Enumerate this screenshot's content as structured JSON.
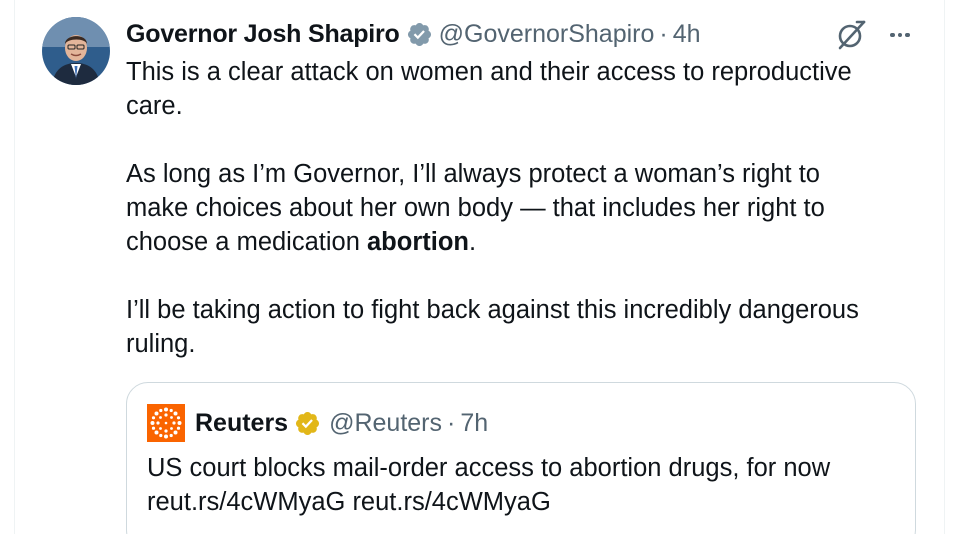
{
  "tweet": {
    "author_name": "Governor Josh Shapiro",
    "handle": "@GovernorShapiro",
    "separator": "·",
    "time": "4h",
    "verified_color": "#829aab",
    "lines": [
      "This is a clear attack on women and their access to reproductive",
      "care.",
      "",
      "As long as I’m Governor, I’ll always protect a woman’s right to",
      "make choices about her own body — that includes her right to"
    ],
    "line6_prefix": "choose a medication ",
    "line6_bold": "abortion",
    "line6_suffix": ".",
    "lines_after": [
      "",
      "I’ll be taking action to fight back against this incredibly dangerous",
      "ruling."
    ]
  },
  "quote": {
    "author_name": "Reuters",
    "handle": "@Reuters",
    "separator": "·",
    "time": "7h",
    "badge_color": "#e2b719",
    "logo_color": "#fa6400",
    "lines": [
      "US court blocks mail-order access to abortion drugs, for now",
      "reut.rs/4cWMyaG reut.rs/4cWMyaG"
    ]
  },
  "icons": {
    "avatar": "avatar-governor",
    "verified": "verified-badge-icon",
    "grok": "grok-icon",
    "more": "more-options-icon",
    "reuters_logo": "reuters-logo",
    "gold_badge": "gold-verified-badge-icon"
  }
}
